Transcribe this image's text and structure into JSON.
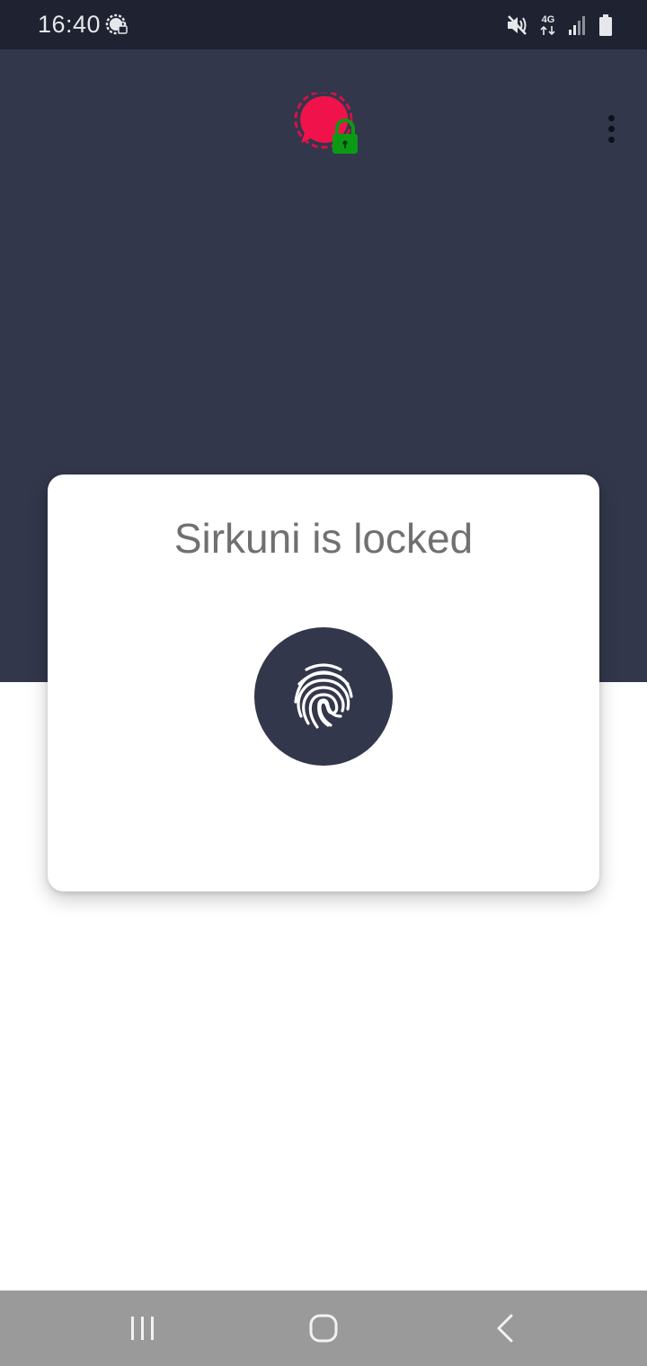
{
  "status_bar": {
    "time": "16:40",
    "network_type": "4G",
    "icons": [
      "app-notification-icon",
      "mute-icon",
      "network-4g-icon",
      "signal-icon",
      "battery-icon"
    ]
  },
  "header": {
    "logo_icon": "chat-bubble-lock-icon",
    "menu_icon": "more-vertical-icon"
  },
  "lock_card": {
    "title": "Sirkuni is locked",
    "unlock_icon": "fingerprint-icon"
  },
  "nav_bar": {
    "icons": [
      "recents-icon",
      "home-icon",
      "back-icon"
    ]
  },
  "colors": {
    "status_bar_bg": "#1f2231",
    "panel_bg": "#32374b",
    "logo_red": "#f0134b",
    "lock_green": "#0c9a14",
    "title_text": "#707070",
    "nav_bar_bg": "#9a9a9a"
  }
}
